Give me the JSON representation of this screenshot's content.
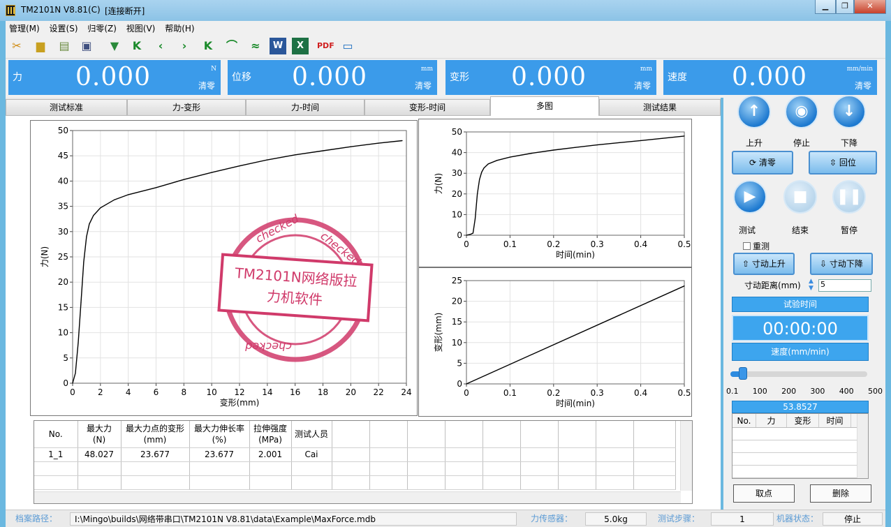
{
  "window": {
    "title": "TM2101N V8.81(C)",
    "status": "[连接断开]"
  },
  "menu": [
    "管理(M)",
    "设置(S)",
    "归零(Z)",
    "视图(V)",
    "帮助(H)"
  ],
  "toolbar": [
    "wrench-icon",
    "folder-open-icon",
    "notepad-icon",
    "clear-icon",
    "trash-icon",
    "first-icon",
    "prev-icon",
    "next-icon",
    "last-icon",
    "curve-icon",
    "multi-curve-icon",
    "word-icon",
    "excel-icon",
    "pdf-icon",
    "screen-icon"
  ],
  "metrics": [
    {
      "label": "力",
      "value": "0.000",
      "unit": "N",
      "zero": "清零"
    },
    {
      "label": "位移",
      "value": "0.000",
      "unit": "mm",
      "zero": "清零"
    },
    {
      "label": "变形",
      "value": "0.000",
      "unit": "mm",
      "zero": "清零"
    },
    {
      "label": "速度",
      "value": "0.000",
      "unit": "mm/min",
      "zero": "清零"
    }
  ],
  "tabs": [
    "测试标准",
    "力-变形",
    "力-时间",
    "变形-时间",
    "多图",
    "测试结果"
  ],
  "chart_data": [
    {
      "type": "line",
      "title": "",
      "xlabel": "变形(mm)",
      "ylabel": "力(N)",
      "xlim": [
        0,
        24
      ],
      "ylim": [
        0,
        50
      ],
      "xticks": [
        0,
        2,
        4,
        6,
        8,
        10,
        12,
        14,
        16,
        18,
        20,
        22,
        24
      ],
      "yticks": [
        0,
        5,
        10,
        15,
        20,
        25,
        30,
        35,
        40,
        45,
        50
      ],
      "x": [
        0,
        0.2,
        0.4,
        0.6,
        0.8,
        1.0,
        1.2,
        1.5,
        2,
        3,
        4,
        6,
        8,
        10,
        12,
        14,
        16,
        18,
        20,
        22,
        23.7
      ],
      "y": [
        0,
        2,
        8,
        16,
        24,
        29,
        31.5,
        33.2,
        34.7,
        36.3,
        37.3,
        38.7,
        40.3,
        41.7,
        43,
        44.2,
        45.2,
        46,
        46.8,
        47.5,
        48.0
      ]
    },
    {
      "type": "line",
      "title": "",
      "xlabel": "时间(min)",
      "ylabel": "力(N)",
      "xlim": [
        0,
        0.5
      ],
      "ylim": [
        0,
        50
      ],
      "xticks": [
        0,
        0.1,
        0.2,
        0.3,
        0.4,
        0.5
      ],
      "yticks": [
        0,
        10,
        20,
        30,
        40,
        50
      ],
      "x": [
        0,
        0.01,
        0.015,
        0.02,
        0.025,
        0.03,
        0.035,
        0.04,
        0.05,
        0.07,
        0.1,
        0.15,
        0.2,
        0.25,
        0.3,
        0.35,
        0.4,
        0.45,
        0.5
      ],
      "y": [
        0,
        0.5,
        1,
        8,
        20,
        27,
        30.5,
        32.5,
        34.5,
        36.2,
        37.8,
        39.7,
        41.2,
        42.5,
        43.7,
        44.8,
        45.8,
        46.9,
        48.0
      ]
    },
    {
      "type": "line",
      "title": "",
      "xlabel": "时间(min)",
      "ylabel": "变形(mm)",
      "xlim": [
        0,
        0.5
      ],
      "ylim": [
        0,
        25
      ],
      "xticks": [
        0,
        0.1,
        0.2,
        0.3,
        0.4,
        0.5
      ],
      "yticks": [
        0,
        5,
        10,
        15,
        20,
        25
      ],
      "x": [
        0,
        0.5
      ],
      "y": [
        0,
        23.7
      ]
    }
  ],
  "table": {
    "headers": [
      [
        "No.",
        ""
      ],
      [
        "最大力",
        "(N)"
      ],
      [
        "最大力点的变形",
        "(mm)"
      ],
      [
        "最大力伸长率",
        "(%)"
      ],
      [
        "拉伸强度",
        "(MPa)"
      ],
      [
        "测试人员",
        ""
      ]
    ],
    "rows": [
      [
        "1_1",
        "48.027",
        "23.677",
        "23.677",
        "2.001",
        "Cai"
      ]
    ]
  },
  "stamp": {
    "line1": "TM2101N网络版拉",
    "line2": "力机软件",
    "ring": "checked"
  },
  "controls": {
    "up": "上升",
    "stop": "停止",
    "down": "下降",
    "clear": "清零",
    "return": "回位",
    "test": "测试",
    "end": "结束",
    "pause": "暂停",
    "retest": "重测",
    "jog_up": "寸动上升",
    "jog_down": "寸动下降",
    "jog_dist_label": "寸动距离(mm)",
    "jog_dist": "5",
    "time_label": "试验时间",
    "time": "00:00:00",
    "speed_label": "速度(mm/min)",
    "slider_ticks": [
      "0.1",
      "100",
      "200",
      "300",
      "400",
      "500"
    ],
    "slider_value": 0.06,
    "readout": "53.8527",
    "mini_headers": [
      "No.",
      "力",
      "变形",
      "时间"
    ],
    "take": "取点",
    "delete": "删除"
  },
  "status": [
    {
      "label": "档案路径：",
      "value": "I:\\Mingo\\builds\\网络带串口\\TM2101N V8.81\\data\\Example\\MaxForce.mdb"
    },
    {
      "label": "力传感器：",
      "value": "5.0kg"
    },
    {
      "label": "测试步骤：",
      "value": "1"
    },
    {
      "label": "机器状态：",
      "value": "停止"
    }
  ]
}
